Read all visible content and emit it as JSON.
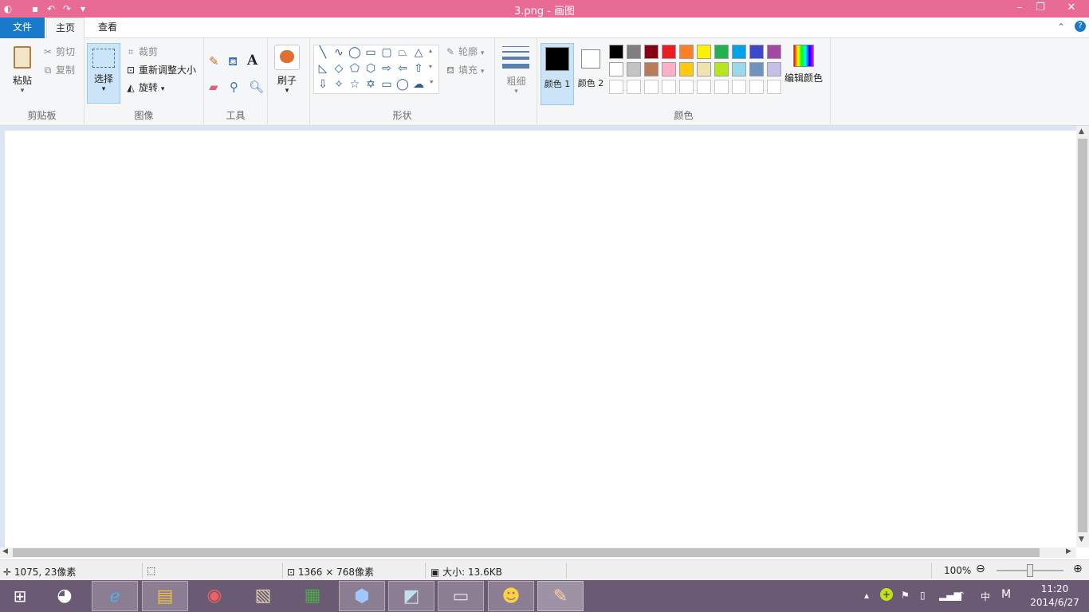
{
  "window": {
    "title": "3.png - 画图"
  },
  "tabs": {
    "file": "文件",
    "home": "主页",
    "view": "查看"
  },
  "ribbon": {
    "clipboard": {
      "label": "剪贴板",
      "paste": "粘贴",
      "cut": "剪切",
      "copy": "复制"
    },
    "image": {
      "label": "图像",
      "select": "选择",
      "crop": "裁剪",
      "resize": "重新调整大小",
      "rotate": "旋转"
    },
    "tools": {
      "label": "工具"
    },
    "brushes": {
      "label": "刷子"
    },
    "shapes": {
      "label": "形状",
      "outline": "轮廓",
      "fill": "填充"
    },
    "size": {
      "label": "粗细"
    },
    "colors": {
      "label": "颜色",
      "color1": "颜色 1",
      "color2": "颜色 2",
      "edit": "编辑颜色",
      "color1_value": "#000000",
      "color2_value": "#ffffff",
      "palette_row1": [
        "#000000",
        "#7f7f7f",
        "#880015",
        "#ed1c24",
        "#ff7f27",
        "#fff200",
        "#22b14c",
        "#00a2e8",
        "#3f48cc",
        "#a349a4"
      ],
      "palette_row2": [
        "#ffffff",
        "#c3c3c3",
        "#b97a57",
        "#ffaec9",
        "#ffc90e",
        "#efe4b0",
        "#b5e61d",
        "#99d9ea",
        "#7092be",
        "#c8bfe7"
      ]
    }
  },
  "status": {
    "cursor": "1075, 23像素",
    "dimensions": "1366 × 768像素",
    "size": "大小: 13.6KB",
    "zoom": "100%"
  },
  "taskbar": {
    "time": "11:20",
    "date": "2014/6/27",
    "ime": "中",
    "ime2": "M"
  }
}
